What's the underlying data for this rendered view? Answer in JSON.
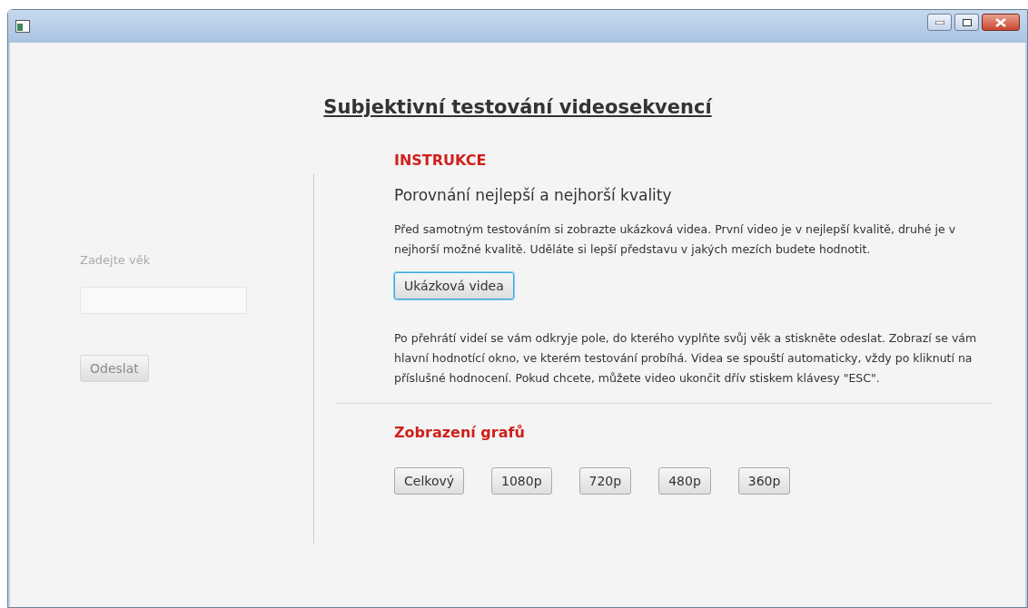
{
  "title": "Subjektivní testování videosekvencí",
  "age_form": {
    "label": "Zadejte věk",
    "field": {
      "disabled": true
    },
    "submit": {
      "label": "Odeslat",
      "disabled": true
    }
  },
  "instructions": {
    "heading": "INSTRUKCE",
    "subheading": "Porovnání nejlepší a nejhorší kvality",
    "paragraph_1": "Před samotným testováním si zobrazte ukázková videa. První video je v nejlepší kvalitě, druhé je v nejhorší možné kvalitě.  Uděláte si lepší představu v jakých mezích budete hodnotit.",
    "sample_button": {
      "label": "Ukázková videa",
      "focused": true
    },
    "paragraph_2": "Po přehrátí videí se vám odkryje pole, do kterého vyplňte svůj věk a stiskněte odeslat. Zobrazí se vám hlavní hodnotící okno, ve kterém testování probíhá. Videa se spouští automaticky, vždy po kliknutí na příslušné hodnocení. Pokud chcete, můžete video ukončit dřív stiskem klávesy \"ESC\"."
  },
  "charts": {
    "heading": "Zobrazení grafů",
    "buttons": [
      "Celkový",
      "1080p",
      "720p",
      "480p",
      "360p"
    ]
  }
}
